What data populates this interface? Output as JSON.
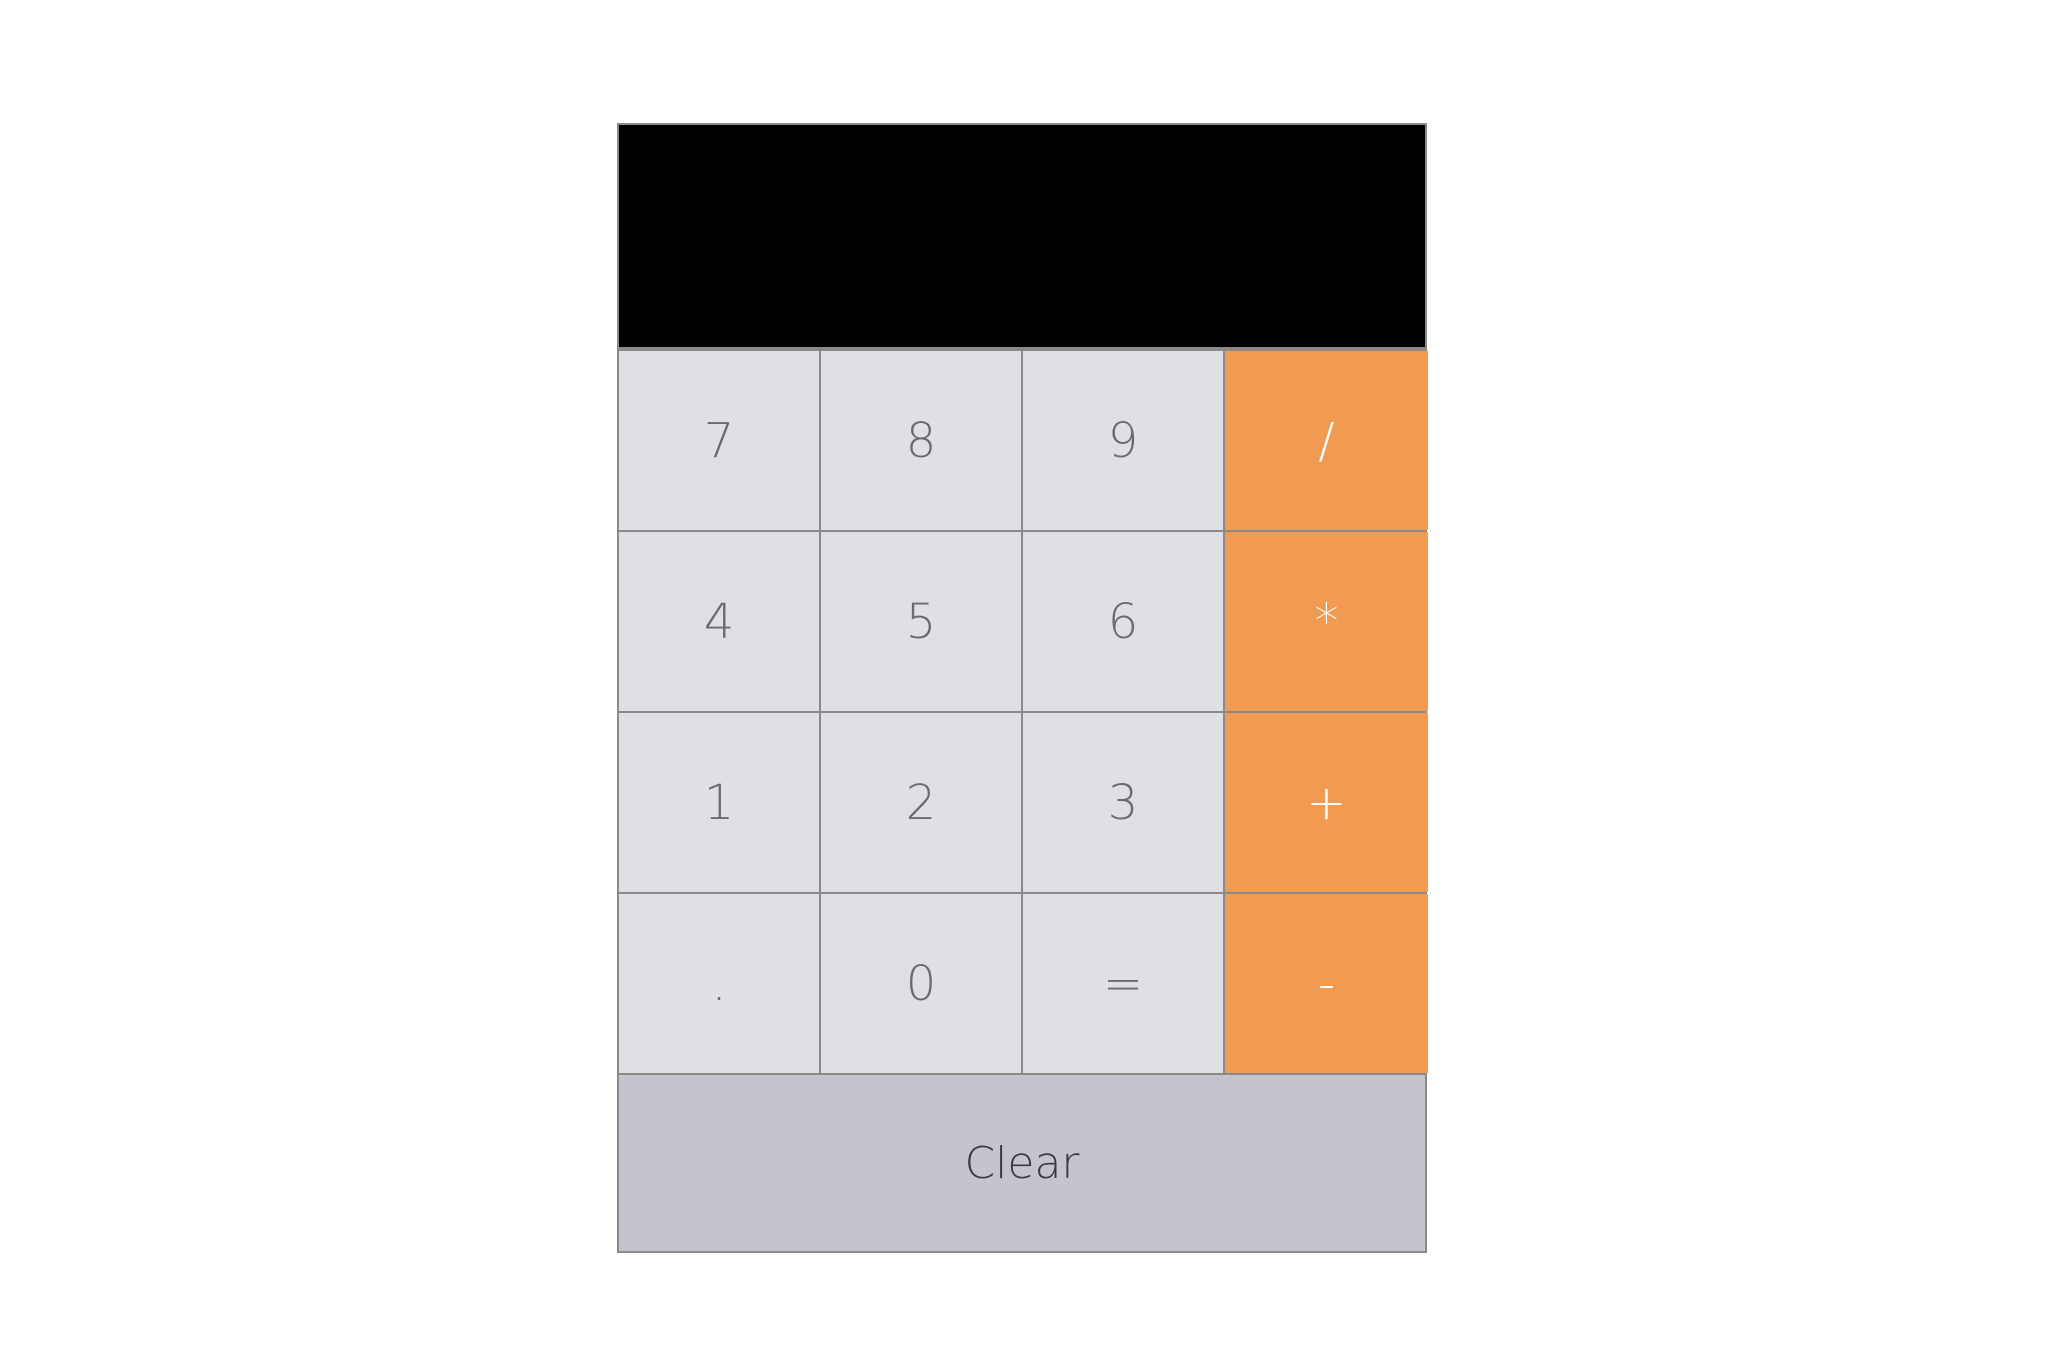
{
  "display": {
    "value": ""
  },
  "keys": {
    "row1": [
      "7",
      "8",
      "9",
      "/"
    ],
    "row2": [
      "4",
      "5",
      "6",
      "*"
    ],
    "row3": [
      "1",
      "2",
      "3",
      "+"
    ],
    "row4": [
      ".",
      "0",
      "=",
      "-"
    ]
  },
  "clear_label": "Clear",
  "colors": {
    "display_bg": "#000000",
    "number_key_bg": "#e0e0e4",
    "operator_key_bg": "#f09a52",
    "clear_bg": "#c5c4cc",
    "border": "#8a8a8a"
  }
}
